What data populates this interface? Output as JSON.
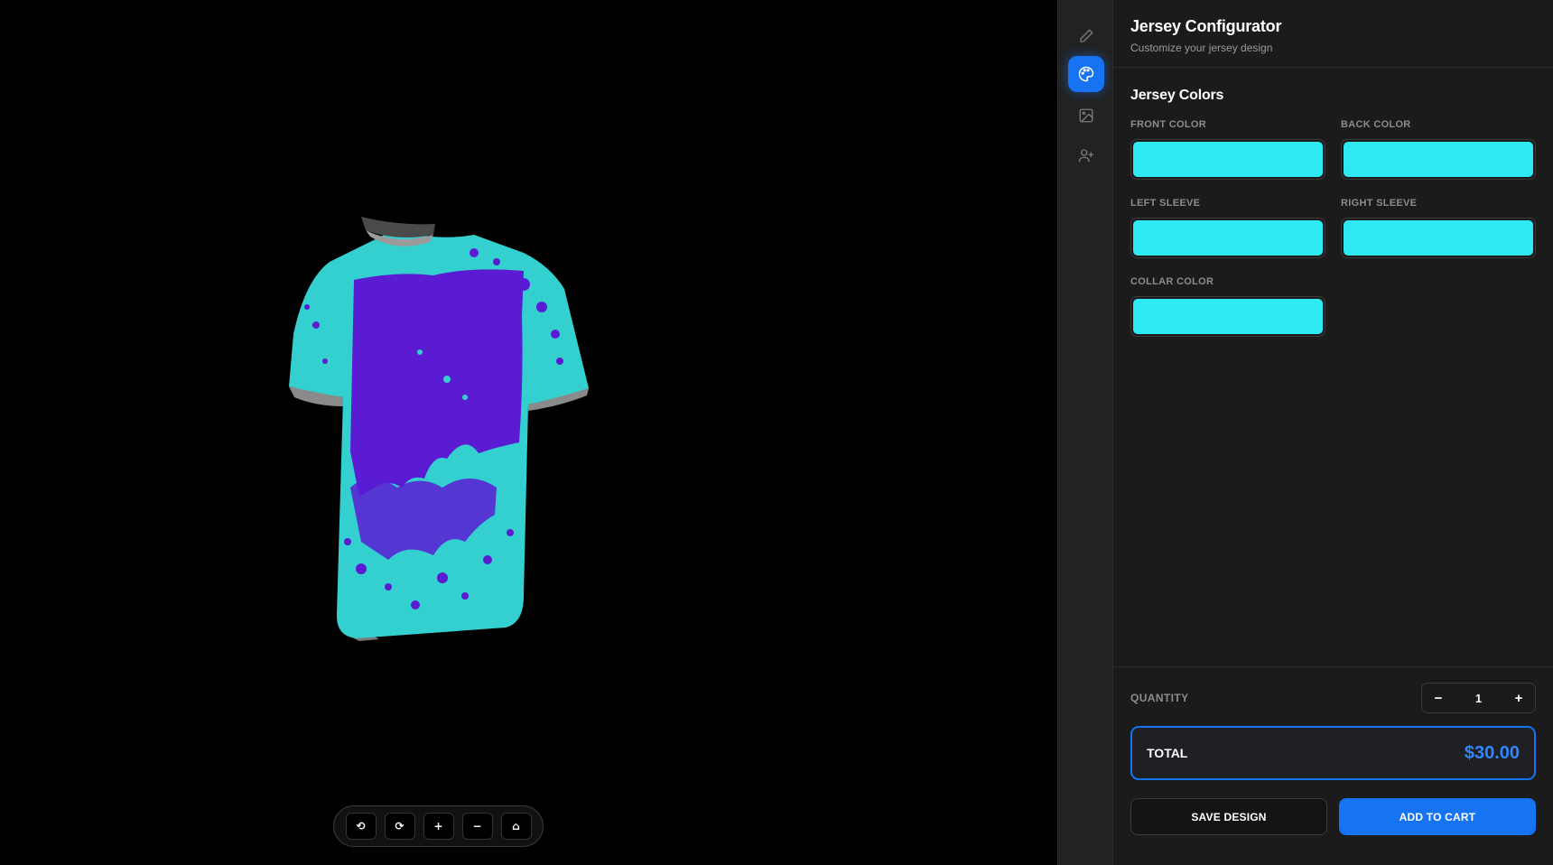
{
  "viewport": {
    "controls": [
      {
        "icon": "rotate-left-icon",
        "glyph": "⟲"
      },
      {
        "icon": "rotate-right-icon",
        "glyph": "⟳"
      },
      {
        "icon": "zoom-in-icon",
        "glyph": "+"
      },
      {
        "icon": "zoom-out-icon",
        "glyph": "−"
      },
      {
        "icon": "home-icon",
        "glyph": "⌂"
      }
    ],
    "jersey_colors": {
      "base": "#34cfcf",
      "pattern": "#5a1bd3",
      "collar_inner": "#8c8c8c"
    }
  },
  "rail": {
    "items": [
      {
        "icon": "pencil-icon",
        "active": false
      },
      {
        "icon": "palette-icon",
        "active": true
      },
      {
        "icon": "image-edit-icon",
        "active": false
      },
      {
        "icon": "user-add-icon",
        "active": false
      }
    ],
    "accent": "#1673f2"
  },
  "panel": {
    "title": "Jersey Configurator",
    "subtitle": "Customize your jersey design",
    "section_title": "Jersey Colors",
    "fields": [
      {
        "label": "FRONT COLOR",
        "color": "#2ee9f2"
      },
      {
        "label": "BACK COLOR",
        "color": "#2ee9f2"
      },
      {
        "label": "LEFT SLEEVE",
        "color": "#2ee9f2"
      },
      {
        "label": "RIGHT SLEEVE",
        "color": "#2ee9f2"
      },
      {
        "label": "COLLAR COLOR",
        "color": "#2ee9f2"
      }
    ],
    "quantity_label": "QUANTITY",
    "quantity_value": "1",
    "minus_label": "−",
    "plus_label": "+",
    "total_label": "TOTAL",
    "total_value": "$30.00",
    "save_label": "SAVE DESIGN",
    "cart_label": "ADD TO CART"
  }
}
